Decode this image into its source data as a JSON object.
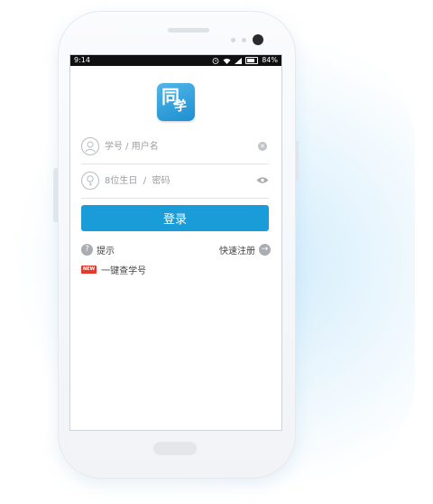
{
  "status_bar": {
    "time": "9:14",
    "battery": "84%",
    "icons": [
      "alarm-icon",
      "wifi-icon",
      "signal-icon",
      "battery-icon"
    ]
  },
  "app": {
    "logo_char_main": "同",
    "logo_char_sub": "学",
    "accent_color": "#1a9cd8"
  },
  "form": {
    "username_placeholder": "学号 / 用户名",
    "password_placeholder": "8位生日  /  密码",
    "login_label": "登录"
  },
  "links": {
    "hint_label": "提示",
    "register_label": "快速注册",
    "query_label": "一键查学号",
    "new_badge": "NEW"
  }
}
